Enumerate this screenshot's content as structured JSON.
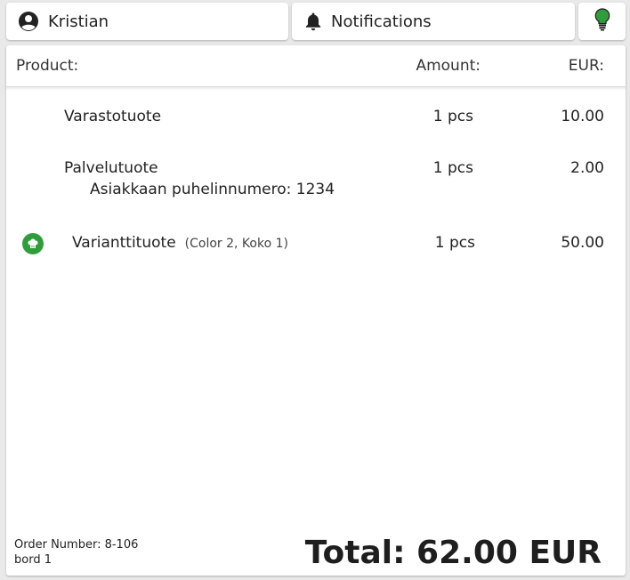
{
  "topbar": {
    "user_name": "Kristian",
    "notifications_label": "Notifications",
    "bulb_color": "#2f9e3a"
  },
  "table": {
    "headers": {
      "product": "Product:",
      "amount": "Amount:",
      "eur": "EUR:"
    },
    "rows": [
      {
        "name": "Varastotuote",
        "amount": "1 pcs",
        "price": "10.00"
      },
      {
        "name": "Palvelutuote",
        "amount": "1 pcs",
        "price": "2.00",
        "sub": "Asiakkaan puhelinnumero: 1234"
      },
      {
        "name": "Varianttituote",
        "variant": "(Color 2, Koko 1)",
        "amount": "1 pcs",
        "price": "50.00",
        "icon": "chef-hat-icon"
      }
    ]
  },
  "footer": {
    "order_number": "Order Number: 8-106",
    "table_name": "bord 1",
    "total": "Total: 62.00 EUR"
  }
}
